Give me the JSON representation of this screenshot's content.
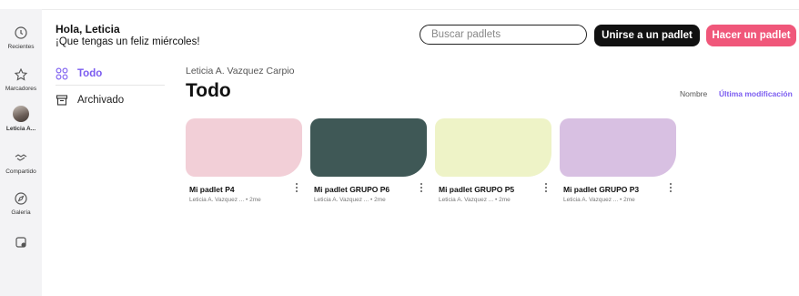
{
  "rail": {
    "items": [
      {
        "icon": "clock-icon",
        "label": "Recientes"
      },
      {
        "icon": "star-icon",
        "label": "Marcadores"
      },
      {
        "icon": "avatar",
        "label": "Leticia A..."
      },
      {
        "icon": "handshake-icon",
        "label": "Compartido"
      },
      {
        "icon": "compass-icon",
        "label": "Galería"
      },
      {
        "icon": "add-folder-icon",
        "label": ""
      }
    ]
  },
  "header": {
    "greeting_name": "Hola, Leticia",
    "greeting_sub": "¡Que tengas un feliz miércoles!",
    "search_placeholder": "Buscar padlets",
    "join_label": "Unirse a un padlet",
    "make_label": "Hacer un padlet"
  },
  "nav": {
    "todo_label": "Todo",
    "archived_label": "Archivado"
  },
  "main": {
    "owner": "Leticia A. Vazquez Carpio",
    "title": "Todo",
    "sort_name": "Nombre",
    "sort_modified": "Última modificación"
  },
  "colors": {
    "accent": "#7b5cf0",
    "make_button": "#f0577a",
    "card_1": "#f2cfd7",
    "card_2": "#3f5856",
    "card_3": "#eef3c7",
    "card_4": "#d8c0e2"
  },
  "cards": [
    {
      "title": "Mi padlet P4",
      "author": "Leticia A. Vazquez ...",
      "age": "• 2me"
    },
    {
      "title": "Mi padlet GRUPO P6",
      "author": "Leticia A. Vazquez ...",
      "age": "• 2me"
    },
    {
      "title": "Mi padlet GRUPO P5",
      "author": "Leticia A. Vazquez ...",
      "age": "• 2me"
    },
    {
      "title": "Mi padlet GRUPO P3",
      "author": "Leticia A. Vazquez ...",
      "age": "• 2me"
    }
  ]
}
